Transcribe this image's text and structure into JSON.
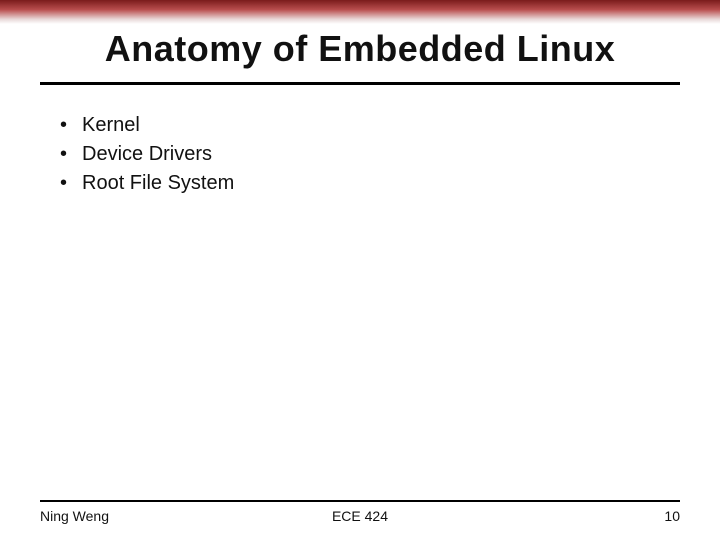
{
  "slide": {
    "title": "Anatomy of Embedded Linux",
    "bullets": [
      "Kernel",
      "Device Drivers",
      "Root File System"
    ]
  },
  "footer": {
    "author": "Ning Weng",
    "course": "ECE 424",
    "page": "10"
  },
  "colors": {
    "accent_dark": "#7a1b1b",
    "accent_mid": "#b84d4d"
  }
}
